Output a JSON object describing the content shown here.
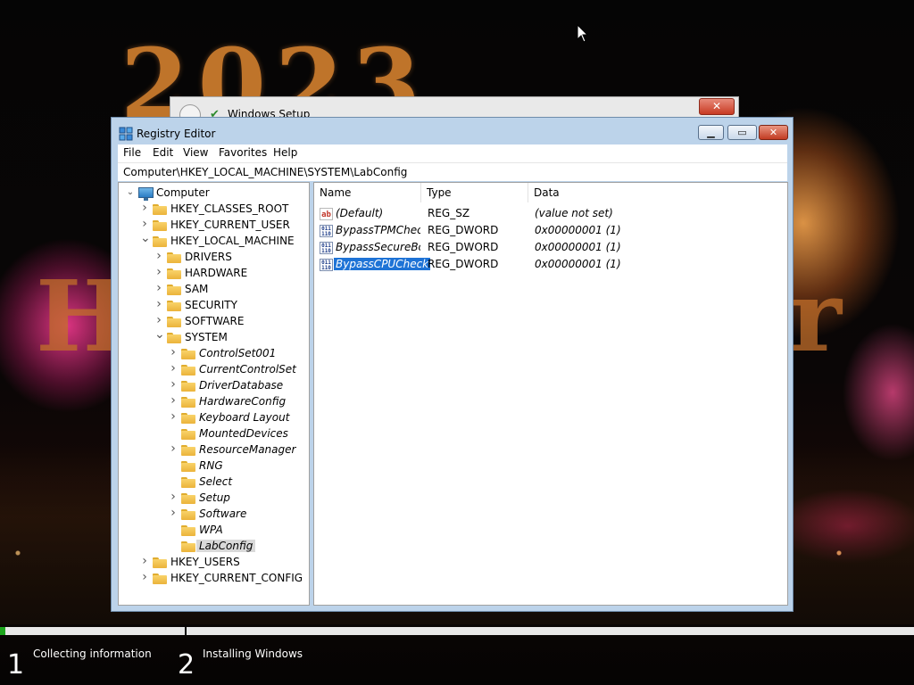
{
  "background": {
    "year_text": "2023",
    "left_letter": "H",
    "right_letter": "r"
  },
  "setup_window": {
    "title": "Windows Setup",
    "close_glyph": "✕",
    "icon": "setup-icon"
  },
  "regedit": {
    "title": "Registry Editor",
    "minimize_glyph": "▁",
    "maximize_glyph": "▭",
    "close_glyph": "✕",
    "menu": [
      "File",
      "Edit",
      "View",
      "Favorites",
      "Help"
    ],
    "address": "Computer\\HKEY_LOCAL_MACHINE\\SYSTEM\\LabConfig",
    "tree": {
      "root": "Computer",
      "nodes": [
        {
          "label": "HKEY_CLASSES_ROOT",
          "level": 1,
          "expander": "collapsed"
        },
        {
          "label": "HKEY_CURRENT_USER",
          "level": 1,
          "expander": "collapsed"
        },
        {
          "label": "HKEY_LOCAL_MACHINE",
          "level": 1,
          "expander": "expanded"
        },
        {
          "label": "DRIVERS",
          "level": 2,
          "expander": "collapsed"
        },
        {
          "label": "HARDWARE",
          "level": 2,
          "expander": "collapsed"
        },
        {
          "label": "SAM",
          "level": 2,
          "expander": "collapsed"
        },
        {
          "label": "SECURITY",
          "level": 2,
          "expander": "collapsed"
        },
        {
          "label": "SOFTWARE",
          "level": 2,
          "expander": "collapsed"
        },
        {
          "label": "SYSTEM",
          "level": 2,
          "expander": "expanded"
        },
        {
          "label": "ControlSet001",
          "level": 3,
          "expander": "collapsed"
        },
        {
          "label": "CurrentControlSet",
          "level": 3,
          "expander": "collapsed"
        },
        {
          "label": "DriverDatabase",
          "level": 3,
          "expander": "collapsed"
        },
        {
          "label": "HardwareConfig",
          "level": 3,
          "expander": "collapsed"
        },
        {
          "label": "Keyboard Layout",
          "level": 3,
          "expander": "collapsed"
        },
        {
          "label": "MountedDevices",
          "level": 3,
          "expander": "none"
        },
        {
          "label": "ResourceManager",
          "level": 3,
          "expander": "collapsed"
        },
        {
          "label": "RNG",
          "level": 3,
          "expander": "none"
        },
        {
          "label": "Select",
          "level": 3,
          "expander": "none"
        },
        {
          "label": "Setup",
          "level": 3,
          "expander": "collapsed"
        },
        {
          "label": "Software",
          "level": 3,
          "expander": "collapsed"
        },
        {
          "label": "WPA",
          "level": 3,
          "expander": "none"
        },
        {
          "label": "LabConfig",
          "level": 3,
          "expander": "none",
          "selected": true
        },
        {
          "label": "HKEY_USERS",
          "level": 1,
          "expander": "collapsed"
        },
        {
          "label": "HKEY_CURRENT_CONFIG",
          "level": 1,
          "expander": "collapsed"
        }
      ]
    },
    "list": {
      "columns": [
        "Name",
        "Type",
        "Data"
      ],
      "rows": [
        {
          "name": "(Default)",
          "type": "REG_SZ",
          "data": "(value not set)",
          "icon": "string-value-icon",
          "icon_text": "ab"
        },
        {
          "name": "BypassTPMCheck",
          "type": "REG_DWORD",
          "data": "0x00000001 (1)",
          "icon": "dword-value-icon",
          "icon_text": "011\n110"
        },
        {
          "name": "BypassSecureBo...",
          "type": "REG_DWORD",
          "data": "0x00000001 (1)",
          "icon": "dword-value-icon",
          "icon_text": "011\n110"
        },
        {
          "name": "BypassCPUCheck",
          "type": "REG_DWORD",
          "data": "0x00000001 (1)",
          "icon": "dword-value-icon",
          "icon_text": "011\n110",
          "selected": true
        }
      ]
    }
  },
  "setup_progress": {
    "fill_fraction_step1": 0.03,
    "steps": [
      {
        "number": "1",
        "label": "Collecting information"
      },
      {
        "number": "2",
        "label": "Installing Windows"
      }
    ],
    "fill_color": "#1ea51e"
  }
}
